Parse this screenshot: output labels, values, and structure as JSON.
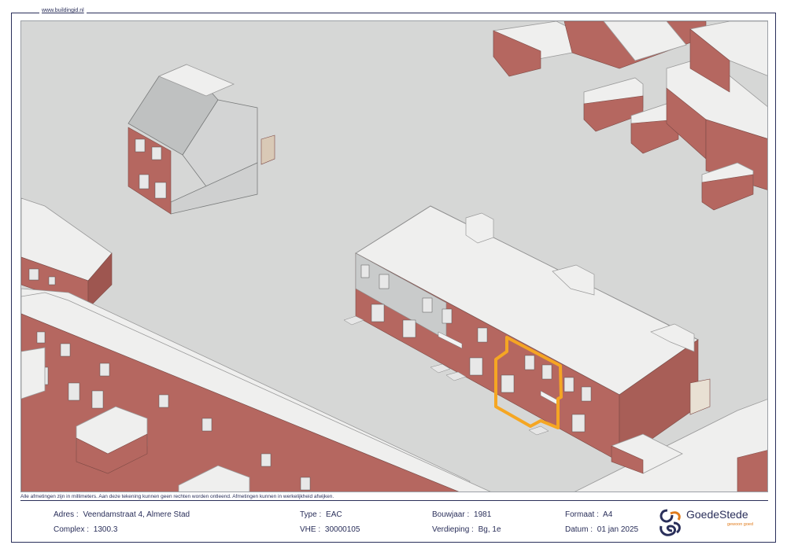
{
  "sheet": {
    "website": "www.buildingid.nl",
    "disclaimer": "Alle afmetingen zijn in millimeters. Aan deze tekening kunnen geen rechten worden ontleend. Afmetingen kunnen in werkelijkheid afwijken."
  },
  "title_block": {
    "adres": {
      "label": "Adres :",
      "value": "Veendamstraat 4, Almere Stad"
    },
    "complex": {
      "label": "Complex :",
      "value": "1300.3"
    },
    "type": {
      "label": "Type :",
      "value": "EAC"
    },
    "vhe": {
      "label": "VHE :",
      "value": "30000105"
    },
    "bouwjaar": {
      "label": "Bouwjaar :",
      "value": "1981"
    },
    "verdieping": {
      "label": "Verdieping :",
      "value": "Bg, 1e"
    },
    "formaat": {
      "label": "Formaat :",
      "value": "A4"
    },
    "datum": {
      "label": "Datum :",
      "value": "01 jan 2025"
    }
  },
  "logo": {
    "name": "GoedeStede",
    "tagline": "gewoon goed",
    "icon": "goedestede-logo-icon"
  },
  "colors": {
    "frame": "#2a2f5a",
    "ground": "#d6d7d6",
    "roof": "#efefee",
    "brick": "#b56760",
    "brick_dark": "#9e5650",
    "siding": "#c9cbcb",
    "highlight": "#f5a623"
  }
}
